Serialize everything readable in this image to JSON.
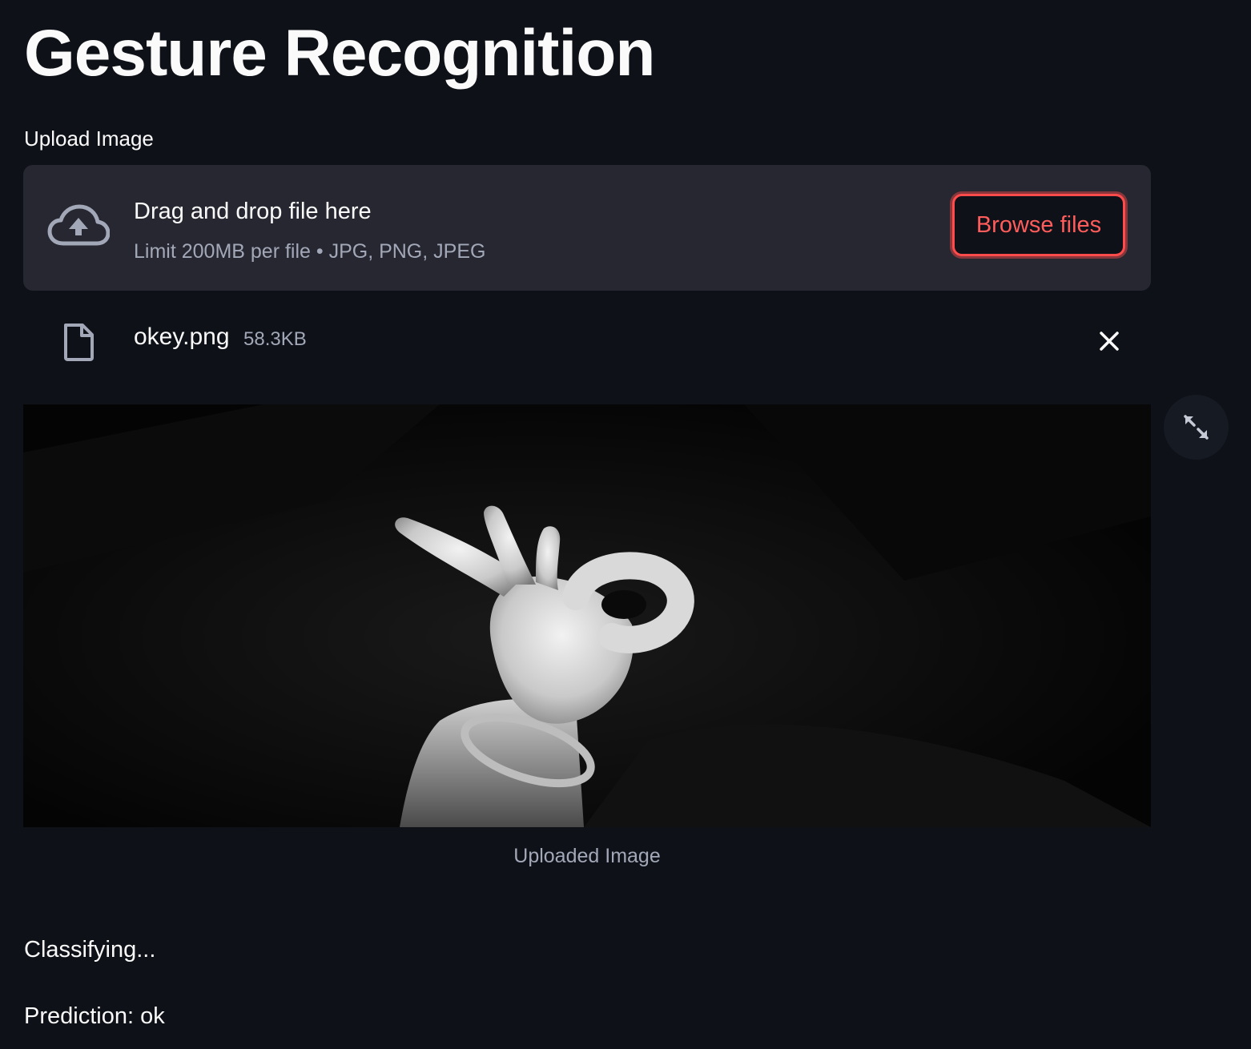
{
  "page": {
    "title": "Gesture Recognition"
  },
  "uploader": {
    "label": "Upload Image",
    "drop_text": "Drag and drop file here",
    "limit_text": "Limit 200MB per file • JPG, PNG, JPEG",
    "browse_label": "Browse files",
    "icon": "cloud-upload-icon"
  },
  "file": {
    "name": "okey.png",
    "size": "58.3KB",
    "icon": "file-icon",
    "remove_icon": "close-icon"
  },
  "image": {
    "caption": "Uploaded Image",
    "fullscreen_icon": "fullscreen-icon"
  },
  "results": {
    "status": "Classifying...",
    "prediction": "Prediction: ok"
  },
  "colors": {
    "background": "#0e1117",
    "dropzone": "#262730",
    "accent": "#ff4b4b",
    "text": "#fafafa",
    "muted": "#a3a8b8"
  }
}
